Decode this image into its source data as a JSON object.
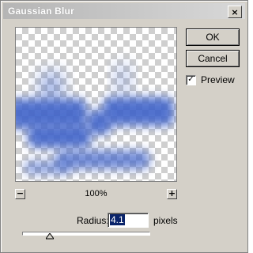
{
  "window": {
    "title": "Gaussian Blur",
    "close_glyph": "×"
  },
  "buttons": {
    "ok_label": "OK",
    "cancel_label": "Cancel"
  },
  "preview_toggle": {
    "label": "Preview",
    "checked": true,
    "check_glyph": "✓"
  },
  "zoom": {
    "level": "100%",
    "minus_glyph": "−",
    "plus_glyph": "+"
  },
  "radius": {
    "label": "Radius:",
    "value": "4.1",
    "unit": "pixels",
    "slider_fraction": 0.22
  },
  "colors": {
    "blur_blue": "#3f63c9",
    "selection": "#0a246a",
    "dialog_bg": "#d4d0c8"
  }
}
